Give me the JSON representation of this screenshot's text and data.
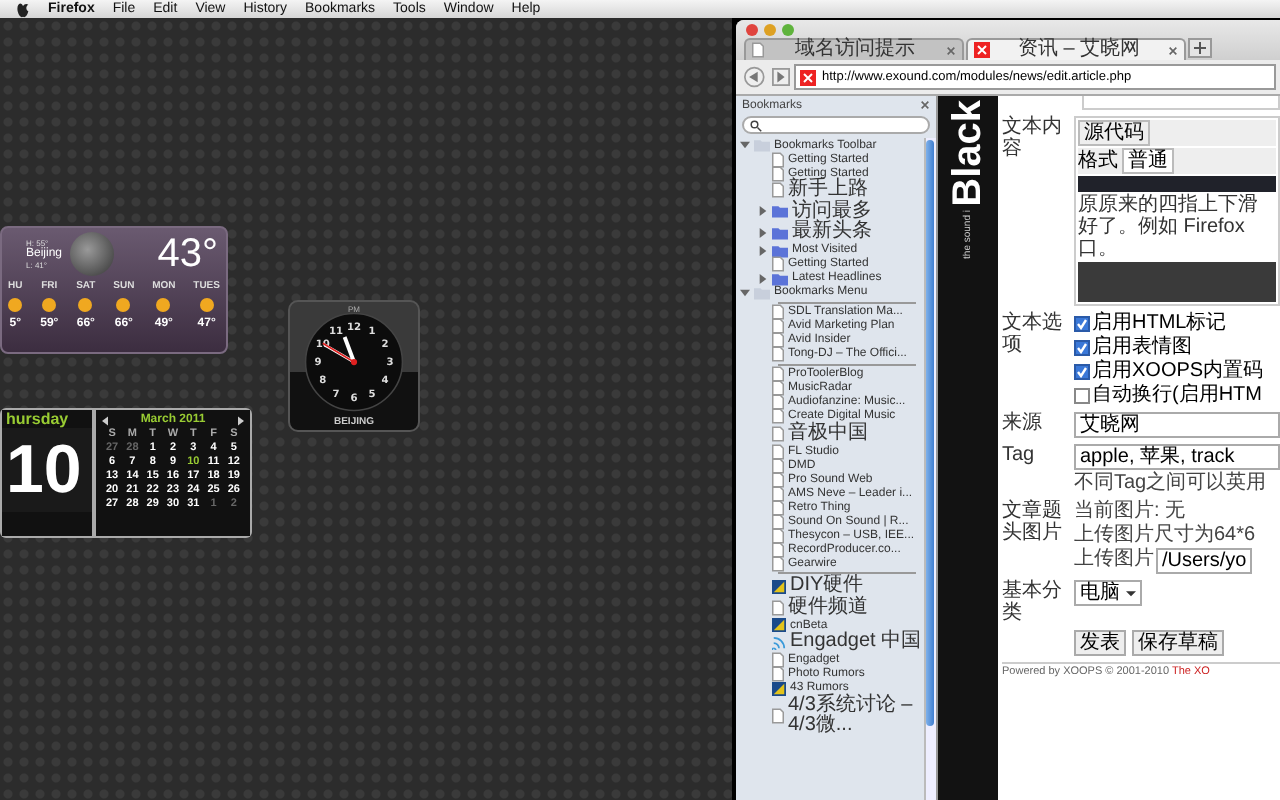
{
  "menu_bar": {
    "items": [
      "Firefox",
      "File",
      "Edit",
      "View",
      "History",
      "Bookmarks",
      "Tools",
      "Window",
      "Help"
    ]
  },
  "weather": {
    "high": "H: 55°",
    "city": "Beijing",
    "low": "L: 41°",
    "temperature": "43°",
    "forecast": [
      {
        "day": "HU",
        "temp": "5°"
      },
      {
        "day": "FRI",
        "temp": "59°"
      },
      {
        "day": "SAT",
        "temp": "66°"
      },
      {
        "day": "SUN",
        "temp": "66°"
      },
      {
        "day": "MON",
        "temp": "49°"
      },
      {
        "day": "TUES",
        "temp": "47°"
      }
    ]
  },
  "clock": {
    "dial": [
      "12",
      "1",
      "2",
      "3",
      "4",
      "5",
      "6",
      "7",
      "8",
      "9",
      "10",
      "11"
    ],
    "period": "PM",
    "city": "BEIJING"
  },
  "calendar": {
    "weekday": "hursday",
    "day": "10",
    "month": "March 2011",
    "weekdays": [
      "S",
      "M",
      "T",
      "W",
      "T",
      "F",
      "S"
    ],
    "weeks": [
      [
        {
          "d": "27",
          "other": true,
          "today": false
        },
        {
          "d": "28",
          "other": true,
          "today": false
        },
        {
          "d": "1",
          "other": false,
          "today": false
        },
        {
          "d": "2",
          "other": false,
          "today": false
        },
        {
          "d": "3",
          "other": false,
          "today": false
        },
        {
          "d": "4",
          "other": false,
          "today": false
        },
        {
          "d": "5",
          "other": false,
          "today": false
        }
      ],
      [
        {
          "d": "6",
          "other": false,
          "today": false
        },
        {
          "d": "7",
          "other": false,
          "today": false
        },
        {
          "d": "8",
          "other": false,
          "today": false
        },
        {
          "d": "9",
          "other": false,
          "today": false
        },
        {
          "d": "10",
          "other": false,
          "today": true
        },
        {
          "d": "11",
          "other": false,
          "today": false
        },
        {
          "d": "12",
          "other": false,
          "today": false
        }
      ],
      [
        {
          "d": "13",
          "other": false,
          "today": false
        },
        {
          "d": "14",
          "other": false,
          "today": false
        },
        {
          "d": "15",
          "other": false,
          "today": false
        },
        {
          "d": "16",
          "other": false,
          "today": false
        },
        {
          "d": "17",
          "other": false,
          "today": false
        },
        {
          "d": "18",
          "other": false,
          "today": false
        },
        {
          "d": "19",
          "other": false,
          "today": false
        }
      ],
      [
        {
          "d": "20",
          "other": false,
          "today": false
        },
        {
          "d": "21",
          "other": false,
          "today": false
        },
        {
          "d": "22",
          "other": false,
          "today": false
        },
        {
          "d": "23",
          "other": false,
          "today": false
        },
        {
          "d": "24",
          "other": false,
          "today": false
        },
        {
          "d": "25",
          "other": false,
          "today": false
        },
        {
          "d": "26",
          "other": false,
          "today": false
        }
      ],
      [
        {
          "d": "27",
          "other": false,
          "today": false
        },
        {
          "d": "28",
          "other": false,
          "today": false
        },
        {
          "d": "29",
          "other": false,
          "today": false
        },
        {
          "d": "30",
          "other": false,
          "today": false
        },
        {
          "d": "31",
          "other": false,
          "today": false
        },
        {
          "d": "1",
          "other": true,
          "today": false
        },
        {
          "d": "2",
          "other": true,
          "today": false
        }
      ]
    ]
  },
  "browser": {
    "tabs": [
      {
        "title": "域名访问提示",
        "selected": false
      },
      {
        "title": "资讯 – 艾晓网",
        "selected": true
      }
    ],
    "url": "http://www.exound.com/modules/news/edit.article.php",
    "sidebar": {
      "title": "Bookmarks",
      "items": [
        {
          "label": "Bookmarks Toolbar",
          "kind": "folder",
          "expanded": true,
          "children": [
            {
              "label": "Getting Started",
              "kind": "page"
            },
            {
              "label": "Getting Started",
              "kind": "page"
            },
            {
              "label": "新手上路",
              "kind": "page"
            },
            {
              "label": "访问最多",
              "kind": "folder",
              "expanded": false
            },
            {
              "label": "最新头条",
              "kind": "folder",
              "expanded": false
            },
            {
              "label": "Most Visited",
              "kind": "folder",
              "expanded": false
            },
            {
              "label": "Getting Started",
              "kind": "page"
            },
            {
              "label": "Latest Headlines",
              "kind": "folder",
              "expanded": false
            }
          ]
        },
        {
          "label": "Bookmarks Menu",
          "kind": "folder",
          "expanded": true,
          "children": [
            {
              "kind": "separator"
            },
            {
              "label": "SDL Translation Ma...",
              "kind": "page"
            },
            {
              "label": "Avid Marketing Plan",
              "kind": "page"
            },
            {
              "label": "Avid Insider",
              "kind": "page"
            },
            {
              "label": "Tong-DJ – The Offici...",
              "kind": "page"
            },
            {
              "kind": "separator"
            },
            {
              "label": "ProToolerBlog",
              "kind": "page"
            },
            {
              "label": "MusicRadar",
              "kind": "page"
            },
            {
              "label": "Audiofanzine: Music...",
              "kind": "page"
            },
            {
              "label": "Create Digital Music",
              "kind": "page"
            },
            {
              "label": "音极中国",
              "kind": "page"
            },
            {
              "label": "FL Studio",
              "kind": "page"
            },
            {
              "label": "DMD",
              "kind": "page"
            },
            {
              "label": "Pro Sound Web",
              "kind": "page"
            },
            {
              "label": "AMS Neve – Leader i...",
              "kind": "page"
            },
            {
              "label": "Retro Thing",
              "kind": "page"
            },
            {
              "label": "Sound On Sound | R...",
              "kind": "page"
            },
            {
              "label": "Thesycon – USB, IEE...",
              "kind": "page"
            },
            {
              "label": "RecordProducer.co...",
              "kind": "page"
            },
            {
              "label": "Gearwire",
              "kind": "page"
            },
            {
              "kind": "separator"
            },
            {
              "label": "DIY硬件",
              "kind": "site"
            },
            {
              "label": "硬件频道",
              "kind": "page"
            },
            {
              "label": "cnBeta",
              "kind": "site"
            },
            {
              "label": "Engadget 中国",
              "kind": "feed"
            },
            {
              "label": "Engadget",
              "kind": "page"
            },
            {
              "label": "Photo Rumors",
              "kind": "page"
            },
            {
              "label": "43 Rumors",
              "kind": "site"
            },
            {
              "label": "4/3系统讨论 – 4/3微...",
              "kind": "page"
            }
          ]
        }
      ]
    },
    "banner": {
      "logo": "Black",
      "tagline": "the sound i"
    },
    "form": {
      "editor": {
        "label": "文本内容",
        "source_button": "源代码",
        "format_label": "格式",
        "format_value": "普通",
        "paragraph": "原原来的四指上下滑好了。例如 Firefox 口。"
      },
      "options": {
        "label": "文本选项",
        "items": [
          {
            "label": "启用HTML标记",
            "checked": true
          },
          {
            "label": "启用表情图",
            "checked": true
          },
          {
            "label": "启用XOOPS内置码",
            "checked": true
          },
          {
            "label": "自动换行(启用HTM",
            "checked": false
          }
        ]
      },
      "source": {
        "label": "来源",
        "value": "艾晓网"
      },
      "tag": {
        "label": "Tag",
        "value": "apple, 苹果, track",
        "hint": "不同Tag之间可以英用"
      },
      "image": {
        "label": "文章题头图片",
        "current": "当前图片: 无",
        "size_note": "上传图片尺寸为64*6",
        "upload_label": "上传图片",
        "upload_value": "/Users/yo"
      },
      "category": {
        "label": "基本分类",
        "value": "电脑"
      },
      "buttons": [
        "发表",
        "保存草稿"
      ]
    },
    "footer": {
      "text": "Powered by XOOPS © 2001-2010",
      "link": "The XO"
    }
  }
}
